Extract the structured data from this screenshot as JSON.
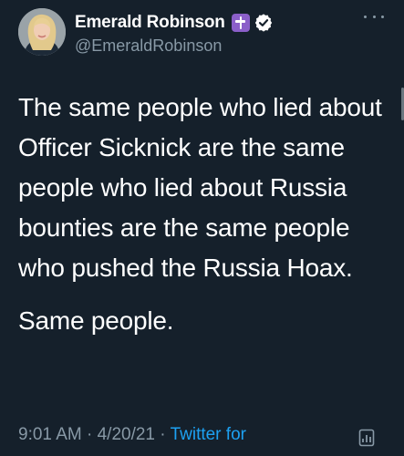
{
  "author": {
    "display_name": "Emerald Robinson",
    "handle": "@EmeraldRobinson",
    "avatar_icon": "profile-photo",
    "badge_icon": "cross-badge-icon",
    "verified_icon": "verified-icon"
  },
  "tweet": {
    "paragraphs": [
      "The same people who lied about Officer Sicknick are the same people who lied about Russia bounties are the same people who pushed the Russia Hoax.",
      "Same people."
    ]
  },
  "meta": {
    "time": "9:01 AM",
    "separator": "·",
    "date": "4/20/21",
    "source": "Twitter for"
  },
  "colors": {
    "background": "#15202b",
    "text": "#ffffff",
    "secondary": "#8899a6",
    "link": "#1da1f2",
    "cross_badge": "#8b5fc9"
  }
}
